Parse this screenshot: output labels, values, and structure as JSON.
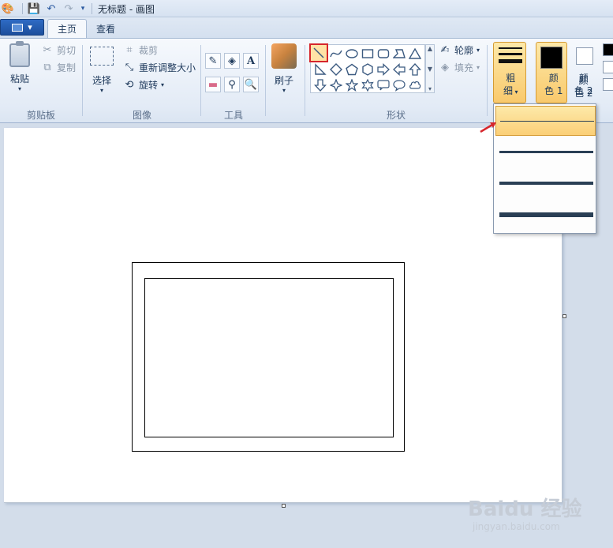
{
  "window": {
    "title": "无标题 - 画图"
  },
  "tabs": [
    {
      "label": "主页",
      "active": true
    },
    {
      "label": "查看",
      "active": false
    }
  ],
  "clipboard": {
    "paste": "粘贴",
    "cut": "剪切",
    "copy": "复制",
    "group": "剪贴板"
  },
  "image": {
    "select": "选择",
    "crop": "裁剪",
    "resize": "重新调整大小",
    "rotate": "旋转",
    "group": "图像"
  },
  "tools": {
    "group": "工具",
    "text_tool_glyph": "A"
  },
  "brush": {
    "label": "刷子"
  },
  "shapes": {
    "group": "形状",
    "outline": "轮廓",
    "fill": "填充",
    "items": [
      "line",
      "curve",
      "oval",
      "rectangle",
      "rounded-rectangle",
      "polygon",
      "triangle",
      "right-triangle",
      "diamond",
      "pentagon",
      "hexagon",
      "right-arrow",
      "left-arrow",
      "up-arrow",
      "down-arrow",
      "four-point-star",
      "five-point-star",
      "six-point-star",
      "rounded-callout",
      "oval-callout",
      "cloud-callout"
    ],
    "selected": "line"
  },
  "size": {
    "label_line1": "粗",
    "label_line2": "细"
  },
  "color1": {
    "label_line1": "颜",
    "label_line2": "色 1",
    "value": "#000000"
  },
  "color2": {
    "label_line1": "颜",
    "label_line2": "色 2",
    "value": "#ffffff"
  },
  "size_dropdown": {
    "options": [
      "1px",
      "3px",
      "5px",
      "8px"
    ],
    "highlighted": 0
  },
  "watermark": {
    "brand": "Baidu 经验",
    "url": "jingyan.baidu.com"
  },
  "colors": {
    "accent_red": "#d6262c",
    "highlight": "#fbcf77"
  }
}
